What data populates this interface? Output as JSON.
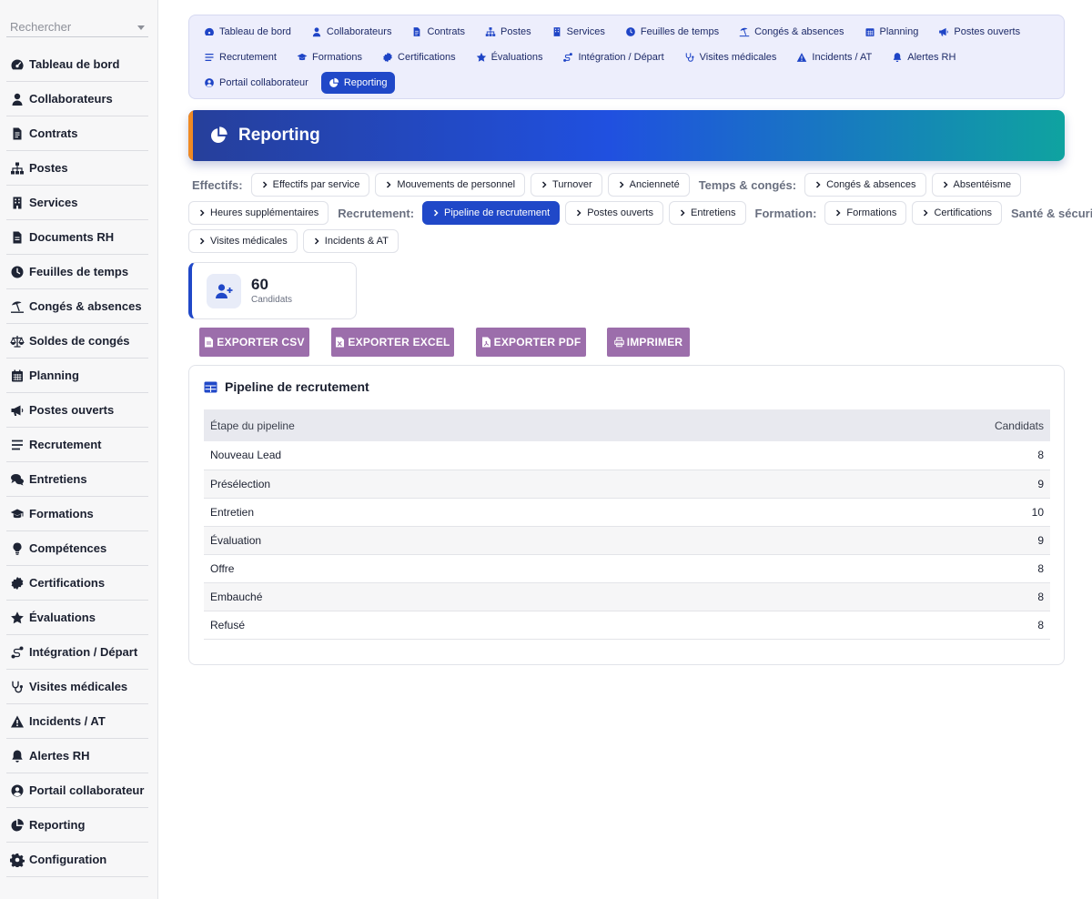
{
  "search": {
    "placeholder": "Rechercher"
  },
  "sidebar": {
    "items": [
      {
        "label": "Tableau de bord",
        "icon": "gauge-icon"
      },
      {
        "label": "Collaborateurs",
        "icon": "user-icon"
      },
      {
        "label": "Contrats",
        "icon": "file-contract-icon"
      },
      {
        "label": "Postes",
        "icon": "sitemap-icon"
      },
      {
        "label": "Services",
        "icon": "building-icon"
      },
      {
        "label": "Documents RH",
        "icon": "file-icon"
      },
      {
        "label": "Feuilles de temps",
        "icon": "clock-icon"
      },
      {
        "label": "Congés & absences",
        "icon": "umbrella-beach-icon"
      },
      {
        "label": "Soldes de congés",
        "icon": "scale-icon"
      },
      {
        "label": "Planning",
        "icon": "calendar-icon"
      },
      {
        "label": "Postes ouverts",
        "icon": "bullhorn-icon"
      },
      {
        "label": "Recrutement",
        "icon": "list-icon"
      },
      {
        "label": "Entretiens",
        "icon": "comments-icon"
      },
      {
        "label": "Formations",
        "icon": "graduation-cap-icon"
      },
      {
        "label": "Compétences",
        "icon": "lightbulb-icon"
      },
      {
        "label": "Certifications",
        "icon": "certificate-icon"
      },
      {
        "label": "Évaluations",
        "icon": "star-icon"
      },
      {
        "label": "Intégration / Départ",
        "icon": "route-icon"
      },
      {
        "label": "Visites médicales",
        "icon": "stethoscope-icon"
      },
      {
        "label": "Incidents / AT",
        "icon": "warning-icon"
      },
      {
        "label": "Alertes RH",
        "icon": "bell-icon"
      },
      {
        "label": "Portail collaborateur",
        "icon": "user-circle-icon"
      },
      {
        "label": "Reporting",
        "icon": "pie-chart-icon"
      },
      {
        "label": "Configuration",
        "icon": "gear-icon"
      }
    ]
  },
  "topnav": {
    "items": [
      {
        "label": "Tableau de bord",
        "icon": "gauge-icon"
      },
      {
        "label": "Collaborateurs",
        "icon": "user-icon"
      },
      {
        "label": "Contrats",
        "icon": "file-contract-icon"
      },
      {
        "label": "Postes",
        "icon": "sitemap-icon"
      },
      {
        "label": "Services",
        "icon": "building-icon"
      },
      {
        "label": "Feuilles de temps",
        "icon": "clock-icon"
      },
      {
        "label": "Congés & absences",
        "icon": "umbrella-beach-icon"
      },
      {
        "label": "Planning",
        "icon": "calendar-icon"
      },
      {
        "label": "Postes ouverts",
        "icon": "bullhorn-icon"
      },
      {
        "label": "Recrutement",
        "icon": "list-icon"
      },
      {
        "label": "Formations",
        "icon": "graduation-cap-icon"
      },
      {
        "label": "Certifications",
        "icon": "certificate-icon"
      },
      {
        "label": "Évaluations",
        "icon": "star-icon"
      },
      {
        "label": "Intégration / Départ",
        "icon": "route-icon"
      },
      {
        "label": "Visites médicales",
        "icon": "stethoscope-icon"
      },
      {
        "label": "Incidents / AT",
        "icon": "warning-icon"
      },
      {
        "label": "Alertes RH",
        "icon": "bell-icon"
      },
      {
        "label": "Portail collaborateur",
        "icon": "user-circle-icon"
      },
      {
        "label": "Reporting",
        "icon": "pie-chart-icon",
        "active": true
      }
    ]
  },
  "banner": {
    "title": "Reporting",
    "icon": "pie-chart-icon"
  },
  "report_tabs": {
    "groups": [
      {
        "label": "Effectifs:",
        "items": [
          "Effectifs par service",
          "Mouvements de personnel",
          "Turnover",
          "Ancienneté"
        ]
      },
      {
        "label": "Temps & congés:",
        "items": [
          "Congés & absences",
          "Absentéisme",
          "Heures supplémentaires"
        ]
      },
      {
        "label": "Recrutement:",
        "items": [
          "Pipeline de recrutement",
          "Postes ouverts",
          "Entretiens"
        ]
      },
      {
        "label": "Formation:",
        "items": [
          "Formations",
          "Certifications"
        ]
      },
      {
        "label": "Santé & sécurité:",
        "items": [
          "Visites médicales",
          "Incidents & AT"
        ]
      }
    ],
    "active": "Pipeline de recrutement"
  },
  "kpi": {
    "value": "60",
    "label": "Candidats",
    "icon": "user-plus-icon"
  },
  "export": {
    "csv": "EXPORTER CSV",
    "excel": "EXPORTER EXCEL",
    "pdf": "EXPORTER PDF",
    "print": "IMPRIMER"
  },
  "table": {
    "title": "Pipeline de recrutement",
    "icon": "table-icon",
    "columns": [
      "Étape du pipeline",
      "Candidats"
    ],
    "rows": [
      [
        "Nouveau Lead",
        "8"
      ],
      [
        "Présélection",
        "9"
      ],
      [
        "Entretien",
        "10"
      ],
      [
        "Évaluation",
        "9"
      ],
      [
        "Offre",
        "8"
      ],
      [
        "Embauché",
        "8"
      ],
      [
        "Refusé",
        "8"
      ]
    ]
  },
  "colors": {
    "accent": "#2048c8",
    "export_button": "#9c6eab",
    "banner_accent": "#f08a24",
    "nav_background": "#edeefc"
  }
}
